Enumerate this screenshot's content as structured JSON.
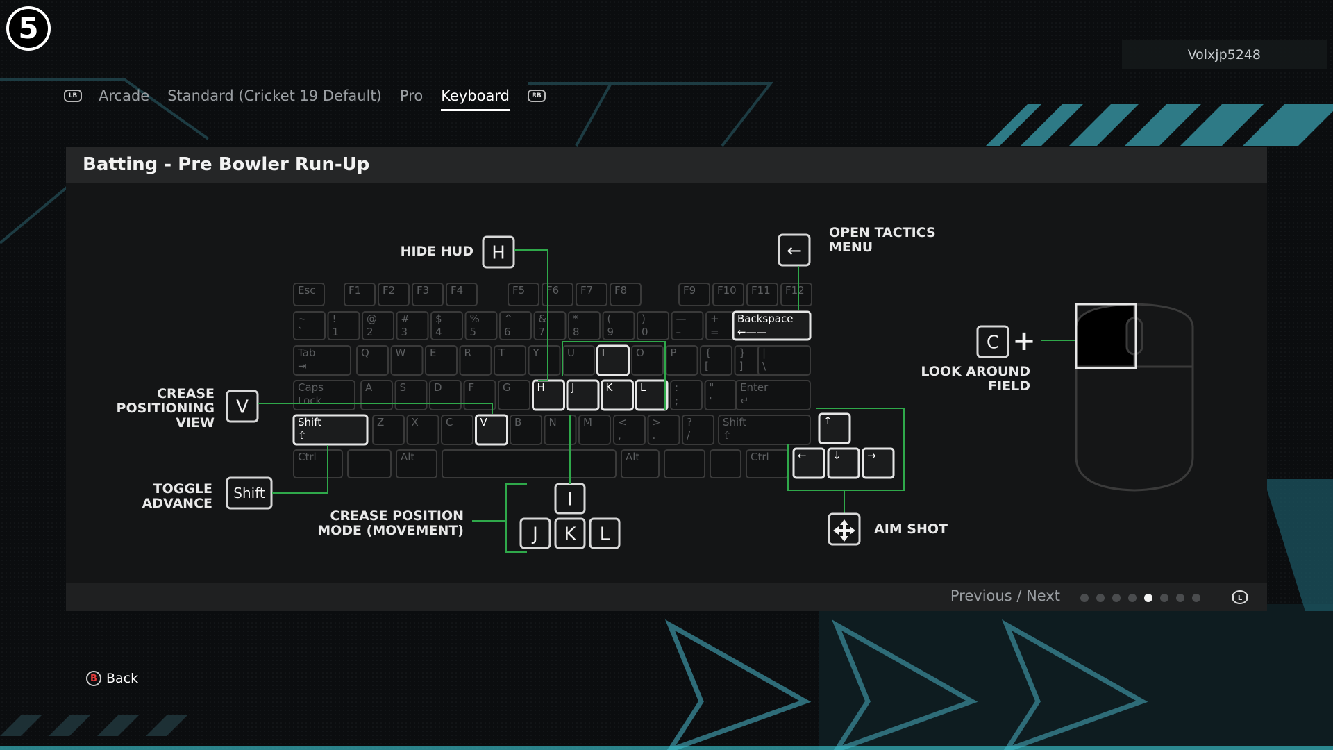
{
  "app": {
    "logo_text": "5"
  },
  "user": {
    "name": "Volxjp5248"
  },
  "tabs": {
    "left_bumper": "LB",
    "right_bumper": "RB",
    "items": [
      {
        "label": "Arcade",
        "active": false
      },
      {
        "label": "Standard (Cricket 19 Default)",
        "active": false
      },
      {
        "label": "Pro",
        "active": false
      },
      {
        "label": "Keyboard",
        "active": true
      }
    ]
  },
  "panel": {
    "title": "Batting - Pre Bowler Run-Up",
    "footer": {
      "nav_label": "Previous / Next",
      "page_count": 8,
      "current_page": 5
    }
  },
  "callouts": {
    "hide_hud": {
      "label": "HIDE HUD",
      "key": "H"
    },
    "open_tactics": {
      "label_line1": "OPEN TACTICS",
      "label_line2": "MENU",
      "key": "←"
    },
    "crease_view": {
      "line1": "CREASE",
      "line2": "POSITIONING",
      "line3": "VIEW",
      "key": "V"
    },
    "toggle_advance": {
      "line1": "TOGGLE",
      "line2": "ADVANCE",
      "key": "Shift"
    },
    "crease_move": {
      "line1": "CREASE POSITION",
      "line2": "MODE (MOVEMENT)",
      "keys": [
        "I",
        "J",
        "K",
        "L"
      ]
    },
    "look_around": {
      "line1": "LOOK AROUND",
      "line2": "FIELD",
      "key": "C",
      "plus": "+"
    },
    "aim_shot": {
      "label": "AIM SHOT"
    }
  },
  "keyboard": {
    "fn_row": [
      "Esc",
      "F1",
      "F2",
      "F3",
      "F4",
      "F5",
      "F6",
      "F7",
      "F8",
      "F9",
      "F10",
      "F11",
      "F12"
    ],
    "num_row": [
      [
        "~",
        "`"
      ],
      [
        "!",
        "1"
      ],
      [
        "@",
        "2"
      ],
      [
        "#",
        "3"
      ],
      [
        "$",
        "4"
      ],
      [
        "%",
        "5"
      ],
      [
        "^",
        "6"
      ],
      [
        "&",
        "7"
      ],
      [
        "*",
        "8"
      ],
      [
        "(",
        "9"
      ],
      [
        ")",
        "0"
      ],
      [
        "—",
        "–"
      ],
      [
        "+",
        "="
      ]
    ],
    "backspace": "Backspace",
    "tab": "Tab",
    "qrow": [
      "Q",
      "W",
      "E",
      "R",
      "T",
      "Y",
      "U",
      "I",
      "O",
      "P"
    ],
    "qrow_extra": [
      [
        "{",
        "["
      ],
      [
        "}",
        "]"
      ],
      [
        "|",
        "\\"
      ]
    ],
    "caps": [
      "Caps",
      "Lock"
    ],
    "arow": [
      "A",
      "S",
      "D",
      "F",
      "G",
      "H",
      "J",
      "K",
      "L"
    ],
    "arow_extra": [
      [
        ":",
        ";"
      ],
      [
        "\"",
        "'"
      ]
    ],
    "enter": "Enter",
    "shift": "Shift",
    "zrow": [
      "Z",
      "X",
      "C",
      "V",
      "B",
      "N",
      "M"
    ],
    "zrow_extra": [
      [
        "<",
        ","
      ],
      [
        ">",
        "."
      ],
      [
        "?",
        "/"
      ]
    ],
    "ctrl": "Ctrl",
    "alt": "Alt",
    "arrows": [
      "↑",
      "←",
      "↓",
      "→"
    ],
    "highlighted": [
      "H",
      "J",
      "K",
      "L",
      "I",
      "V",
      "Shift",
      "Backspace"
    ]
  },
  "back": {
    "button": "B",
    "label": "Back"
  },
  "colors": {
    "accent": "#2fa84a",
    "teal": "#3fd0dc",
    "key_border": "#3a3a3a",
    "key_highlight": "#e6e6e6"
  }
}
